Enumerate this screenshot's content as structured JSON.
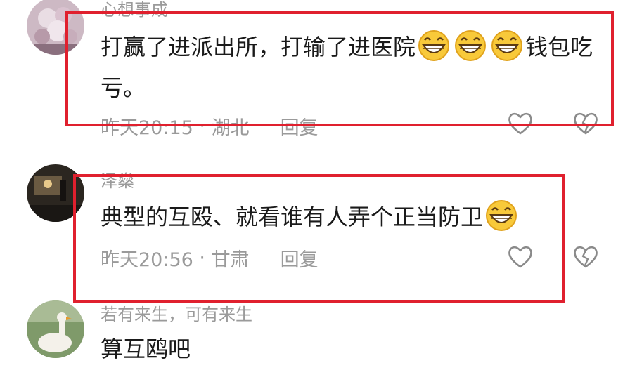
{
  "comments": [
    {
      "username": "心想事成",
      "text_before_emoji": "打赢了进派出所，打输了进医院",
      "emoji_name": "grinning-face-emoji",
      "emoji_count": 3,
      "text_after_emoji": "钱包吃亏。",
      "time": "昨天20:15",
      "location": "湖北",
      "reply_label": "回复"
    },
    {
      "username": "泽燊",
      "text_before_emoji": "典型的互殴、就看谁有人弄个正当防卫",
      "emoji_name": "grinning-face-emoji",
      "emoji_count": 1,
      "time": "昨天20:56",
      "location": "甘肃",
      "reply_label": "回复"
    },
    {
      "username": "若有来生，可有来生",
      "text": "算互鸥吧"
    }
  ],
  "colors": {
    "highlight_border": "#e0202e",
    "meta_text": "#9a9a9a",
    "body_text": "#1a1a1a"
  },
  "icons": {
    "like": "heart-outline-icon",
    "dislike": "broken-heart-icon"
  }
}
